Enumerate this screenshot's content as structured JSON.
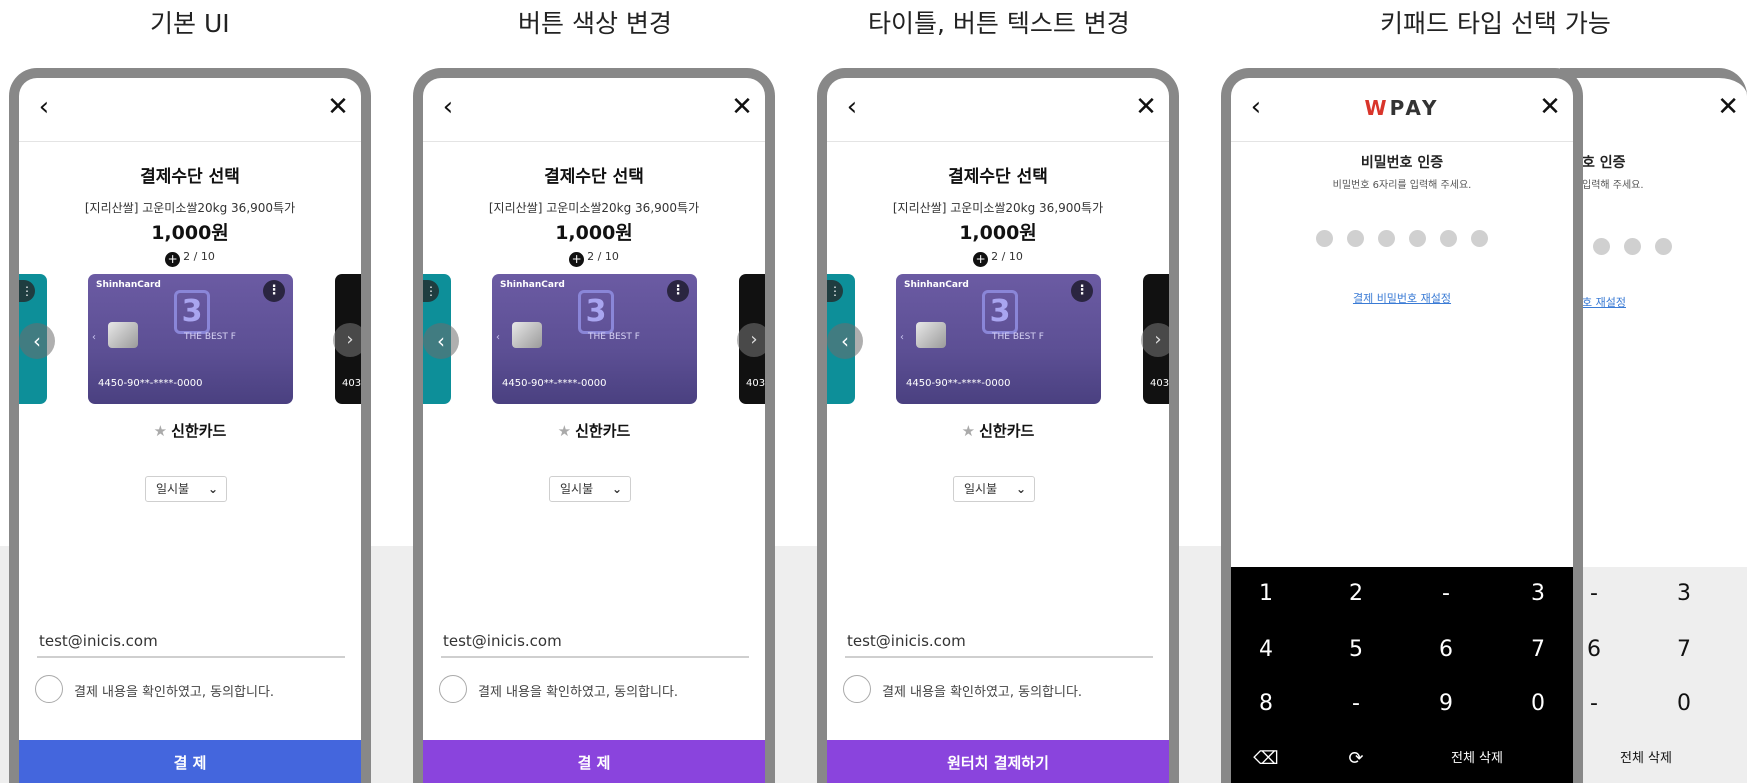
{
  "captions": [
    "기본 UI",
    "버튼 색상 변경",
    "타이틀, 버튼 텍스트 변경",
    "키패드 타입 선택 가능"
  ],
  "common": {
    "back_glyph": "‹",
    "close_glyph": "✕",
    "title": "결제수단 선택",
    "product": "[지리산쌀] 고운미소쌀20kg 36,900특가",
    "price": "1,000원",
    "pager_plus": "+",
    "pager": "2 / 10",
    "card_brand": "ShinhanCard",
    "card_menu": "⋮",
    "card_badge": "3",
    "card_best": "THE BEST F",
    "card_arrow": "‹",
    "card_number": "4450-90**-****-0000",
    "side_card_number": "403",
    "nav_left": "‹",
    "nav_right": "›",
    "card_star": "★",
    "card_name": "신한카드",
    "installment": "일시불",
    "installment_chevron": "⌄",
    "email": "test@inicis.com",
    "agree": "결제 내용을 확인하였고, 동의합니다."
  },
  "phones": [
    {
      "button_label": "결 제",
      "button_color": "#4466dd"
    },
    {
      "button_label": "결 제",
      "button_color": "#8a44dd"
    },
    {
      "button_label": "원터치 결제하기",
      "button_color": "#8a44dd"
    }
  ],
  "keypad_phone": {
    "logo_w": "W",
    "logo_rest": "PAY",
    "title": "비밀번호 인증",
    "subtitle": "비밀번호 6자리를 입력해 주세요.",
    "reset": "결제 비밀번호 재설정",
    "pin_dots": 6,
    "keys": [
      [
        "1",
        "2",
        "-",
        "3"
      ],
      [
        "4",
        "5",
        "6",
        "7"
      ],
      [
        "8",
        "-",
        "9",
        "0"
      ],
      [
        "⌫",
        "⟳",
        "전체 삭제"
      ]
    ]
  },
  "keypad_phone_b": {
    "title": "호 인증",
    "subtitle": "입력해 주세요.",
    "reset": "호 재설정",
    "keys": [
      [
        "-",
        "3"
      ],
      [
        "6",
        "7"
      ],
      [
        "-",
        "0"
      ],
      [
        "전체 삭제"
      ]
    ]
  }
}
